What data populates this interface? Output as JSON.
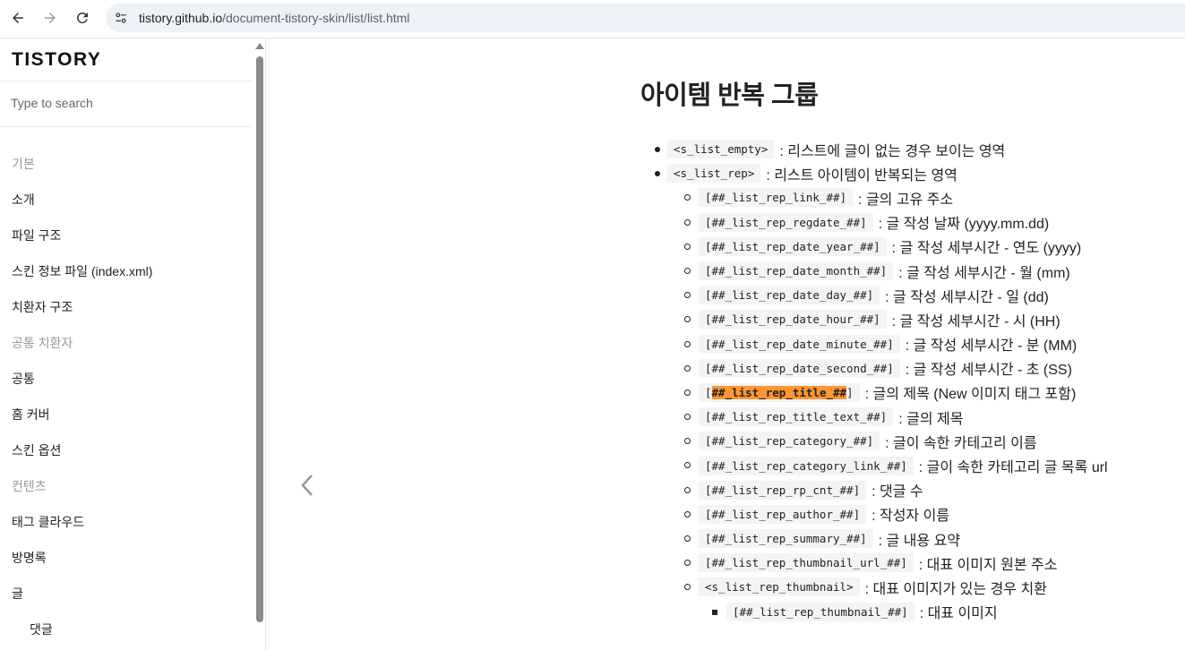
{
  "browser": {
    "url_host": "tistory.github.io",
    "url_path": "/document-tistory-skin/list/list.html"
  },
  "sidebar": {
    "logo": "TISTORY",
    "search_placeholder": "Type to search",
    "items": [
      {
        "type": "section",
        "label": "기본"
      },
      {
        "type": "item",
        "label": "소개"
      },
      {
        "type": "item",
        "label": "파일 구조"
      },
      {
        "type": "item",
        "label": "스킨 정보 파일 (index.xml)"
      },
      {
        "type": "item",
        "label": "치환자 구조"
      },
      {
        "type": "section",
        "label": "공통 치환자"
      },
      {
        "type": "item",
        "label": "공통"
      },
      {
        "type": "item",
        "label": "홈 커버"
      },
      {
        "type": "item",
        "label": "스킨 옵션"
      },
      {
        "type": "section",
        "label": "컨텐츠"
      },
      {
        "type": "item",
        "label": "태그 클라우드"
      },
      {
        "type": "item",
        "label": "방명록"
      },
      {
        "type": "item",
        "label": "글"
      },
      {
        "type": "sub",
        "label": "댓글"
      }
    ]
  },
  "main": {
    "title": "아이템 반복 그룹",
    "list": [
      {
        "level": 1,
        "code": "<s_list_empty>",
        "desc": ": 리스트에 글이 없는 경우 보이는 영역"
      },
      {
        "level": 1,
        "code": "<s_list_rep>",
        "desc": ": 리스트 아이템이 반복되는 영역"
      },
      {
        "level": 2,
        "code": "[##_list_rep_link_##]",
        "desc": ": 글의 고유 주소"
      },
      {
        "level": 2,
        "code": "[##_list_rep_regdate_##]",
        "desc": ": 글 작성 날짜 (yyyy.mm.dd)"
      },
      {
        "level": 2,
        "code": "[##_list_rep_date_year_##]",
        "desc": ": 글 작성 세부시간 - 연도 (yyyy)"
      },
      {
        "level": 2,
        "code": "[##_list_rep_date_month_##]",
        "desc": ": 글 작성 세부시간 - 월 (mm)"
      },
      {
        "level": 2,
        "code": "[##_list_rep_date_day_##]",
        "desc": ": 글 작성 세부시간 - 일 (dd)"
      },
      {
        "level": 2,
        "code": "[##_list_rep_date_hour_##]",
        "desc": ": 글 작성 세부시간 - 시 (HH)"
      },
      {
        "level": 2,
        "code": "[##_list_rep_date_minute_##]",
        "desc": ": 글 작성 세부시간 - 분 (MM)"
      },
      {
        "level": 2,
        "code": "[##_list_rep_date_second_##]",
        "desc": ": 글 작성 세부시간 - 초 (SS)"
      },
      {
        "level": 2,
        "code_prefix": "[",
        "code_highlight": "##_list_rep_title_##",
        "code_suffix": "]",
        "desc": ": 글의 제목 (New 이미지 태그 포함)"
      },
      {
        "level": 2,
        "code": "[##_list_rep_title_text_##]",
        "desc": ": 글의 제목"
      },
      {
        "level": 2,
        "code": "[##_list_rep_category_##]",
        "desc": ": 글이 속한 카테고리 이름"
      },
      {
        "level": 2,
        "code": "[##_list_rep_category_link_##]",
        "desc": ": 글이 속한 카테고리 글 목록 url"
      },
      {
        "level": 2,
        "code": "[##_list_rep_rp_cnt_##]",
        "desc": ": 댓글 수"
      },
      {
        "level": 2,
        "code": "[##_list_rep_author_##]",
        "desc": ": 작성자 이름"
      },
      {
        "level": 2,
        "code": "[##_list_rep_summary_##]",
        "desc": ": 글 내용 요약"
      },
      {
        "level": 2,
        "code": "[##_list_rep_thumbnail_url_##]",
        "desc": ": 대표 이미지 원본 주소"
      },
      {
        "level": 2,
        "code": "<s_list_rep_thumbnail>",
        "desc": ": 대표 이미지가 있는 경우 치환"
      },
      {
        "level": 3,
        "code": "[##_list_rep_thumbnail_##]",
        "desc": ": 대표 이미지"
      }
    ]
  }
}
